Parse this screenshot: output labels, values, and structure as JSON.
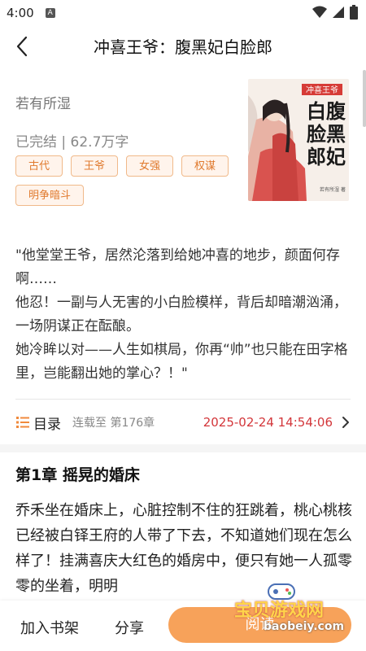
{
  "status_bar": {
    "time": "4:00",
    "sim_label": "A"
  },
  "header": {
    "title": "冲喜王爷：腹黑妃白脸郎"
  },
  "book": {
    "author": "若有所湿",
    "meta": "已完结 | 62.7万字",
    "tags": [
      "古代",
      "王爷",
      "女强",
      "权谋",
      "明争暗斗"
    ],
    "cover": {
      "top_label": "冲喜王爷",
      "title_chars": [
        "白腹",
        "脸黑",
        "郎妃"
      ],
      "author_line": "若有所湿 著"
    }
  },
  "synopsis": [
    "\"他堂堂王爷，居然沦落到给她冲喜的地步，颜面何存啊……",
    "他忍！一副与人无害的小白脸模样，背后却暗潮汹涌，一场阴谋正在酝酿。",
    "她冷眸以对——人生如棋局，你再“帅”也只能在田字格里，岂能翻出她的掌心？！\""
  ],
  "toc": {
    "label": "目录",
    "status": "连载至 第176章",
    "updated": "2025-02-24 14:54:06"
  },
  "chapter": {
    "title": "第1章 摇晃的婚床",
    "body": "乔禾坐在婚床上，心脏控制不住的狂跳着，桃心桃核已经被白铎王府的人带了下去，不知道她们现在怎么样了！挂满喜庆大红色的婚房中，便只有她一人孤零零的坐着，明明"
  },
  "bottom_bar": {
    "add_shelf": "加入书架",
    "share": "分享",
    "read": "阅读"
  },
  "watermark": {
    "line1": "宝贝游戏网",
    "line2": "baobeiy.com"
  },
  "colors": {
    "accent": "#f7a25a",
    "tag_text": "#e07a2e",
    "timestamp": "#d3363a"
  }
}
